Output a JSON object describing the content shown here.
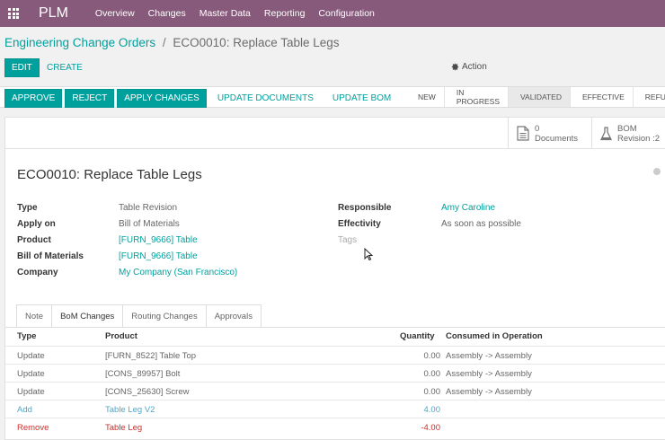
{
  "navbar": {
    "app_name": "PLM",
    "menu": [
      "Overview",
      "Changes",
      "Master Data",
      "Reporting",
      "Configuration"
    ],
    "bg_color": "#875a7b"
  },
  "breadcrumb": {
    "parent": "Engineering Change Orders",
    "separator": "/",
    "current": "ECO0010: Replace Table Legs"
  },
  "controls": {
    "edit": "EDIT",
    "create": "CREATE",
    "action": "Action",
    "action_icon": "gear-icon"
  },
  "statusbar": {
    "buttons": [
      {
        "label": "APPROVE",
        "style": "primary"
      },
      {
        "label": "REJECT",
        "style": "primary"
      },
      {
        "label": "APPLY CHANGES",
        "style": "primary"
      },
      {
        "label": "UPDATE DOCUMENTS",
        "style": "link"
      },
      {
        "label": "UPDATE BOM",
        "style": "link"
      }
    ],
    "stages": [
      "NEW",
      "IN PROGRESS",
      "VALIDATED",
      "EFFECTIVE",
      "REFUSED"
    ],
    "active_stage": "VALIDATED"
  },
  "smart_buttons": {
    "documents": {
      "count": "0",
      "label": "Documents",
      "icon": "document-icon"
    },
    "bom": {
      "line1": "BOM",
      "line2": "Revision :2",
      "icon": "flask-icon"
    }
  },
  "record": {
    "title": "ECO0010: Replace Table Legs",
    "left_fields": [
      {
        "label": "Type",
        "value": "Table Revision",
        "link": false
      },
      {
        "label": "Apply on",
        "value": "Bill of Materials",
        "link": false
      },
      {
        "label": "Product",
        "value": "[FURN_9666] Table",
        "link": true
      },
      {
        "label": "Bill of Materials",
        "value": "[FURN_9666] Table",
        "link": true
      },
      {
        "label": "Company",
        "value": "My Company (San Francisco)",
        "link": true
      }
    ],
    "right_fields": [
      {
        "label": "Responsible",
        "value": "Amy Caroline",
        "link": true
      },
      {
        "label": "Effectivity",
        "value": "As soon as possible",
        "link": false
      },
      {
        "label": "",
        "value": "Tags",
        "placeholder": true
      }
    ]
  },
  "tabs": [
    "Note",
    "BoM Changes",
    "Routing Changes",
    "Approvals"
  ],
  "active_tab": "BoM Changes",
  "bom_table": {
    "headers": [
      "Type",
      "Product",
      "Quantity",
      "Consumed in Operation"
    ],
    "rows": [
      {
        "type": "Update",
        "product": "[FURN_8522] Table Top",
        "quantity": "0.00",
        "operation": "Assembly -> Assembly",
        "kind": "update"
      },
      {
        "type": "Update",
        "product": "[CONS_89957] Bolt",
        "quantity": "0.00",
        "operation": "Assembly -> Assembly",
        "kind": "update"
      },
      {
        "type": "Update",
        "product": "[CONS_25630] Screw",
        "quantity": "0.00",
        "operation": "Assembly -> Assembly",
        "kind": "update"
      },
      {
        "type": "Add",
        "product": "Table Leg V2",
        "quantity": "4.00",
        "operation": "",
        "kind": "add"
      },
      {
        "type": "Remove",
        "product": "Table Leg",
        "quantity": "-4.00",
        "operation": "",
        "kind": "remove"
      }
    ]
  },
  "colors": {
    "primary": "#00a09d",
    "add": "#4fa7c9",
    "remove": "#c9302c"
  }
}
